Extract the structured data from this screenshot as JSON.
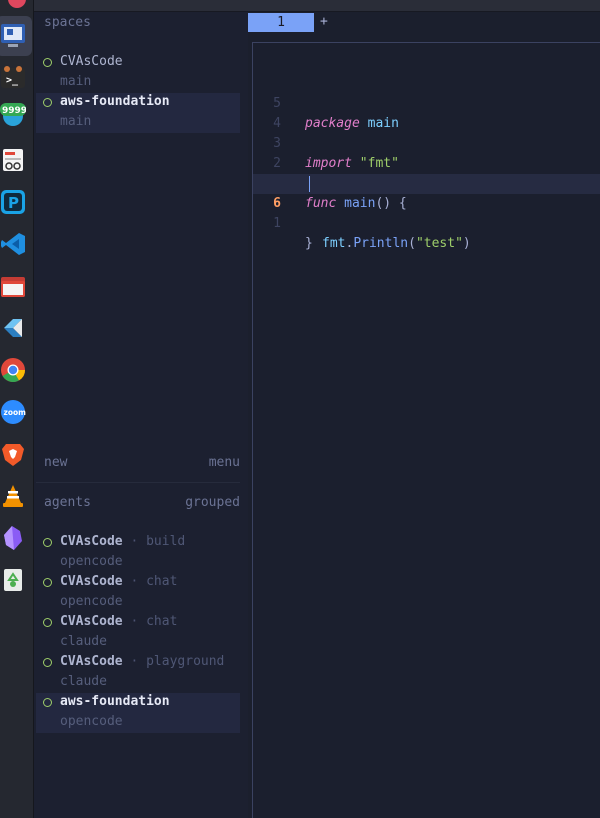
{
  "dock": {
    "apps": [
      {
        "name": "screen-settings-icon",
        "color": "#3b6fd6"
      },
      {
        "name": "terminal-icon",
        "color": "#2d2d2d"
      },
      {
        "name": "telegram-icon",
        "color": "#2aa3d9",
        "badge": "9999"
      },
      {
        "name": "document-viewer-icon",
        "color": "#e04a3a"
      },
      {
        "name": "pcloud-icon",
        "color": "#1aa3e6"
      },
      {
        "name": "vscode-icon",
        "color": "#1f8fe0"
      },
      {
        "name": "files-icon",
        "color": "#e0483a"
      },
      {
        "name": "stack-icon",
        "color": "#3aa0e0"
      },
      {
        "name": "chrome-icon",
        "color": "#e0483a"
      },
      {
        "name": "zoom-icon",
        "color": "#2d8cff",
        "label": "zoom"
      },
      {
        "name": "brave-icon",
        "color": "#f25a29"
      },
      {
        "name": "vlc-icon",
        "color": "#f39200"
      },
      {
        "name": "obsidian-icon",
        "color": "#8a5cf5"
      },
      {
        "name": "recycle-icon",
        "color": "#4caf50"
      }
    ]
  },
  "spaces": {
    "title": "spaces",
    "items": [
      {
        "name": "CVAsCode",
        "branch": "main",
        "selected": false
      },
      {
        "name": "aws-foundation",
        "branch": "main",
        "selected": true
      }
    ],
    "new_label": "new",
    "menu_label": "menu"
  },
  "agents": {
    "title": "agents",
    "grouped_label": "grouped",
    "items": [
      {
        "name": "CVAsCode",
        "sep": "·",
        "kind": "build",
        "agent": "opencode",
        "selected": false
      },
      {
        "name": "CVAsCode",
        "sep": "·",
        "kind": "chat",
        "agent": "opencode",
        "selected": false
      },
      {
        "name": "CVAsCode",
        "sep": "·",
        "kind": "chat",
        "agent": "claude",
        "selected": false
      },
      {
        "name": "CVAsCode",
        "sep": "·",
        "kind": "playground",
        "agent": "claude",
        "selected": false
      },
      {
        "name": "aws-foundation",
        "sep": "",
        "kind": "",
        "agent": "opencode",
        "selected": true
      }
    ]
  },
  "editor": {
    "tab_label": "1",
    "add_tab": "+",
    "lines": [
      {
        "num": "5",
        "kw": "package",
        "rest": " main"
      },
      {
        "num": "4"
      },
      {
        "num": "3",
        "kw": "import",
        "str": "\"fmt\""
      },
      {
        "num": "2"
      },
      {
        "num": "1",
        "kw": "func",
        "fn": "main",
        "tail": "() {"
      },
      {
        "num": "6",
        "call_obj": "fmt",
        "call_fn": "Println",
        "call_str": "\"test\"",
        "current": true
      },
      {
        "num": "1",
        "tail": "}"
      }
    ]
  },
  "colors": {
    "accent": "#7aa2f7",
    "keyword": "#e27fcb",
    "string": "#9ece6a",
    "status_dot": "#9ece6a",
    "current_line_number": "#ff9e64"
  }
}
